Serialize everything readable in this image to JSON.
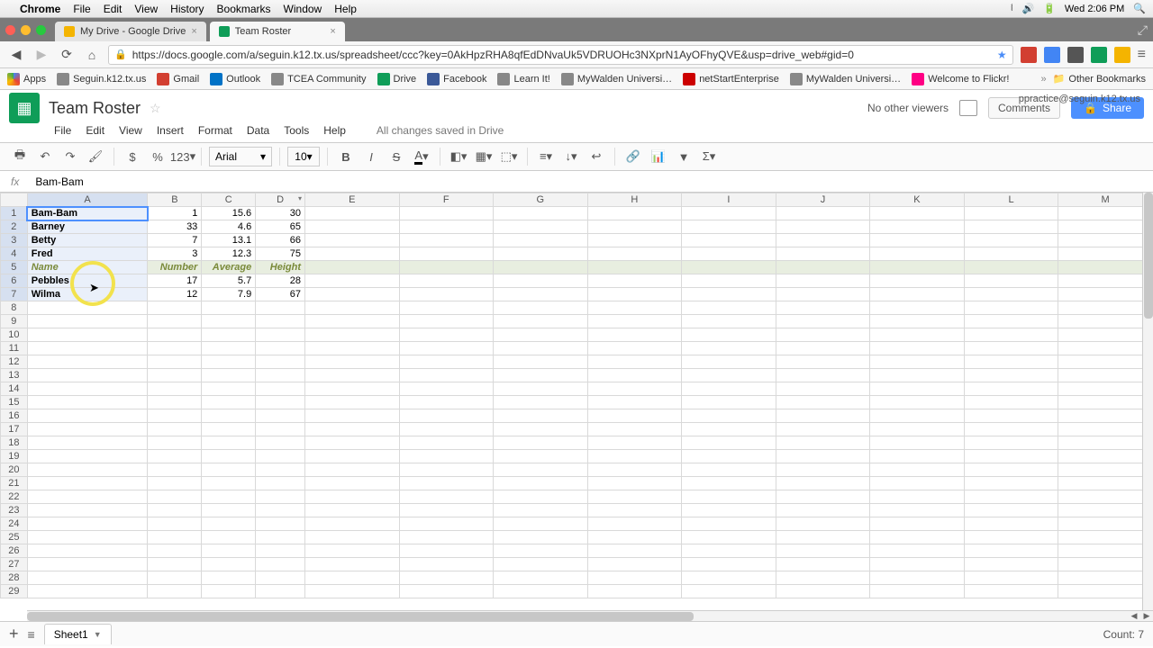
{
  "mac_menu": {
    "apple": "",
    "app": "Chrome",
    "items": [
      "File",
      "Edit",
      "View",
      "History",
      "Bookmarks",
      "Window",
      "Help"
    ],
    "clock": "Wed 2:06 PM"
  },
  "tabs": [
    {
      "title": "My Drive - Google Drive",
      "favicon": "drive",
      "active": false
    },
    {
      "title": "Team Roster",
      "favicon": "sheets",
      "active": true
    }
  ],
  "url": "https://docs.google.com/a/seguin.k12.tx.us/spreadsheet/ccc?key=0AkHpzRHA8qfEdDNvaUk5VDRUOHc3NXprN1AyOFhyQVE&usp=drive_web#gid=0",
  "bookmarks": [
    "Apps",
    "Seguin.k12.tx.us",
    "Gmail",
    "Outlook",
    "TCEA Community",
    "Drive",
    "Facebook",
    "Learn It!",
    "MyWalden Universi…",
    "netStartEnterprise",
    "MyWalden Universi…",
    "Welcome to Flickr!"
  ],
  "bookmarks_other": "Other Bookmarks",
  "doc": {
    "title": "Team Roster",
    "menus": [
      "File",
      "Edit",
      "View",
      "Insert",
      "Format",
      "Data",
      "Tools",
      "Help"
    ],
    "save_status": "All changes saved in Drive",
    "viewers": "No other viewers",
    "comments": "Comments",
    "share": "Share",
    "account": "ppractice@seguin.k12.tx.us"
  },
  "toolbar": {
    "font": "Arial",
    "size": "10",
    "numfmt": "123"
  },
  "formula": {
    "label": "fx",
    "value": "Bam-Bam"
  },
  "columns": [
    "A",
    "B",
    "C",
    "D",
    "E",
    "F",
    "G",
    "H",
    "I",
    "J",
    "K",
    "L",
    "M"
  ],
  "rows": [
    {
      "n": 1,
      "a": "Bam-Bam",
      "b": "1",
      "c": "15.6",
      "d": "30",
      "bold": true,
      "sel": true,
      "active": true
    },
    {
      "n": 2,
      "a": "Barney",
      "b": "33",
      "c": "4.6",
      "d": "65",
      "bold": true,
      "sel": true
    },
    {
      "n": 3,
      "a": "Betty",
      "b": "7",
      "c": "13.1",
      "d": "66",
      "bold": true,
      "sel": true
    },
    {
      "n": 4,
      "a": "Fred",
      "b": "3",
      "c": "12.3",
      "d": "75",
      "bold": true,
      "sel": true
    },
    {
      "n": 5,
      "hdr": true,
      "a": "Name",
      "b": "Number",
      "c": "Average",
      "d": "Height",
      "sel": true
    },
    {
      "n": 6,
      "a": "Pebbles",
      "b": "17",
      "c": "5.7",
      "d": "28",
      "bold": true,
      "sel": true
    },
    {
      "n": 7,
      "a": "Wilma",
      "b": "12",
      "c": "7.9",
      "d": "67",
      "bold": true,
      "sel": true
    },
    {
      "n": 8
    },
    {
      "n": 9
    },
    {
      "n": 10
    },
    {
      "n": 11
    },
    {
      "n": 12
    },
    {
      "n": 13
    },
    {
      "n": 14
    },
    {
      "n": 15
    },
    {
      "n": 16
    },
    {
      "n": 17
    },
    {
      "n": 18
    },
    {
      "n": 19
    },
    {
      "n": 20
    },
    {
      "n": 21
    },
    {
      "n": 22
    },
    {
      "n": 23
    },
    {
      "n": 24
    },
    {
      "n": 25
    },
    {
      "n": 26
    },
    {
      "n": 27
    },
    {
      "n": 28
    },
    {
      "n": 29
    }
  ],
  "sheet_tab": "Sheet1",
  "status": "Count: 7"
}
